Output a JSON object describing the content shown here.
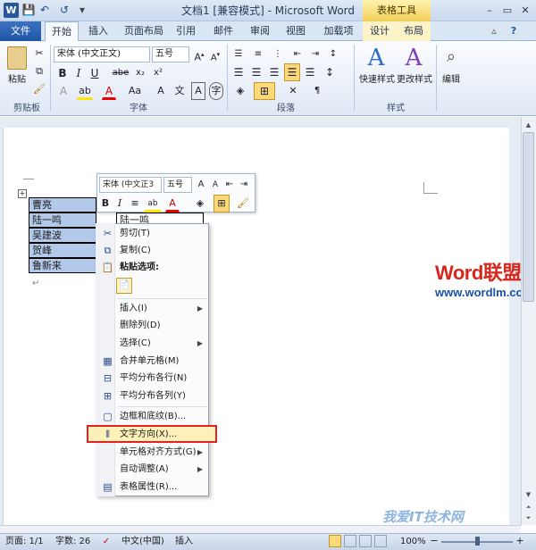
{
  "window": {
    "title": "文档1 [兼容模式] - Microsoft Word",
    "context_tab_header": "表格工具",
    "minimize": "–",
    "restore": "▭",
    "close": "✕"
  },
  "tabs": [
    "文件",
    "开始",
    "插入",
    "页面布局",
    "引用",
    "邮件",
    "审阅",
    "视图",
    "加载项",
    "设计",
    "布局"
  ],
  "ribbon": {
    "paste_label": "粘贴",
    "font_name": "宋体 (中文正文)",
    "font_size": "五号",
    "groups": [
      "剪贴板",
      "字体",
      "段落",
      "样式",
      "编辑"
    ],
    "quick_styles": "快速样式",
    "change_styles": "更改样式",
    "editing": "编辑",
    "font_buttons": [
      "B",
      "I",
      "U",
      "abe",
      "x₂",
      "x²"
    ]
  },
  "table": {
    "left_column": [
      "曹亮",
      "陆一鸣",
      "吴建波",
      "贺峰",
      "鲁新来"
    ],
    "right_first": "陆一鸣"
  },
  "mini_toolbar": {
    "font_name": "宋体 (中文正3",
    "font_size": "五号",
    "bold": "B",
    "italic": "I"
  },
  "context_menu": {
    "items": [
      {
        "label": "剪切(T)",
        "icon": "scissors-icon"
      },
      {
        "label": "复制(C)",
        "icon": "copy-icon"
      },
      {
        "label": "粘贴选项:",
        "icon": "paste-icon"
      },
      {
        "label": "插入(I)",
        "icon": ""
      },
      {
        "label": "删除列(D)",
        "icon": ""
      },
      {
        "label": "选择(C)",
        "icon": ""
      },
      {
        "label": "合并单元格(M)",
        "icon": "merge-cells-icon"
      },
      {
        "label": "平均分布各行(N)",
        "icon": "distribute-rows-icon"
      },
      {
        "label": "平均分布各列(Y)",
        "icon": "distribute-columns-icon"
      },
      {
        "label": "边框和底纹(B)...",
        "icon": "borders-icon"
      },
      {
        "label": "文字方向(X)...",
        "icon": "text-direction-icon"
      },
      {
        "label": "单元格对齐方式(G)",
        "icon": ""
      },
      {
        "label": "自动调整(A)",
        "icon": ""
      },
      {
        "label": "表格属性(R)...",
        "icon": "table-properties-icon"
      }
    ]
  },
  "watermark": {
    "brand": "Word联盟",
    "url": "www.wordlm.com",
    "bottom": "我爱IT技术网"
  },
  "statusbar": {
    "page": "页面: 1/1",
    "words": "字数: 26",
    "language": "中文(中国)",
    "mode": "插入",
    "zoom": "100%"
  },
  "colors": {
    "accent": "#2b579a",
    "highlight_border": "#e32222",
    "selection": "#b3c9ea"
  }
}
